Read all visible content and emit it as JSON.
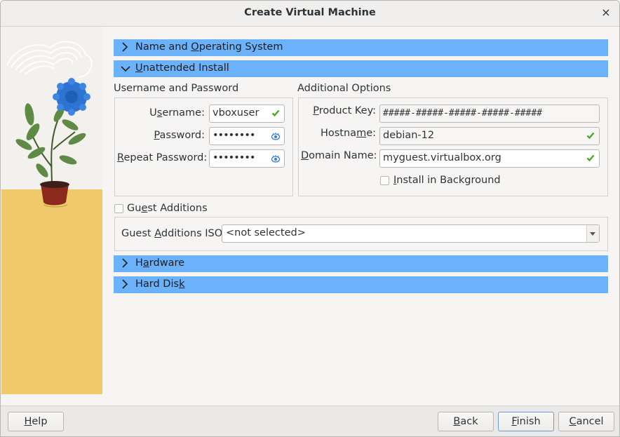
{
  "window": {
    "title": "Create Virtual Machine",
    "close_glyph": "×"
  },
  "sections": {
    "name_os": {
      "label_pre": "Name and ",
      "label_ul": "O",
      "label_post": "perating System",
      "expanded": false
    },
    "unattended": {
      "label_pre": "",
      "label_ul": "U",
      "label_post": "nattended Install",
      "expanded": true
    },
    "hardware": {
      "label_pre": "H",
      "label_ul": "a",
      "label_post": "rdware",
      "expanded": false
    },
    "hard_disk": {
      "label_pre": "Hard Dis",
      "label_ul": "k",
      "label_post": "",
      "expanded": false
    }
  },
  "credentials": {
    "title": "Username and Password",
    "username": {
      "label_pre": "U",
      "label_ul": "s",
      "label_post": "ername:",
      "value": "vboxuser",
      "status_icon": "check-icon"
    },
    "password": {
      "label_pre": "",
      "label_ul": "P",
      "label_post": "assword:",
      "value": "••••••••",
      "status_icon": "eye-icon"
    },
    "repeat_password": {
      "label_pre": "",
      "label_ul": "R",
      "label_post": "epeat Password:",
      "value": "••••••••",
      "status_icon": "eye-icon"
    }
  },
  "additional": {
    "title": "Additional Options",
    "product_key": {
      "label_pre": "",
      "label_ul": "P",
      "label_post": "roduct Key:",
      "value": "#####-#####-#####-#####-#####"
    },
    "hostname": {
      "label_pre": "Hostna",
      "label_ul": "m",
      "label_post": "e:",
      "value": "debian-12",
      "status_icon": "check-icon"
    },
    "domain": {
      "label_pre": "",
      "label_ul": "D",
      "label_post": "omain Name:",
      "value": "myguest.virtualbox.org",
      "status_icon": "check-icon"
    },
    "install_background": {
      "label_pre": "",
      "label_ul": "I",
      "label_post": "nstall in Background",
      "checked": false
    }
  },
  "guest_additions": {
    "checkbox": {
      "label_pre": "Gu",
      "label_ul": "e",
      "label_post": "st Additions",
      "checked": false
    },
    "iso": {
      "label_pre": "Guest ",
      "label_ul": "A",
      "label_post": "dditions ISO:",
      "value": "<not selected>"
    }
  },
  "buttons": {
    "help": {
      "label_pre": "",
      "label_ul": "H",
      "label_post": "elp"
    },
    "back": {
      "label_pre": "",
      "label_ul": "B",
      "label_post": "ack"
    },
    "finish": {
      "label_pre": "",
      "label_ul": "F",
      "label_post": "inish"
    },
    "cancel": {
      "label_pre": "",
      "label_ul": "C",
      "label_post": "ancel"
    }
  },
  "colors": {
    "section_header": "#6cb2fb",
    "check_green": "#4aa82d",
    "eye_blue": "#3b7dd8",
    "wizard_floor": "#f0c96a"
  }
}
